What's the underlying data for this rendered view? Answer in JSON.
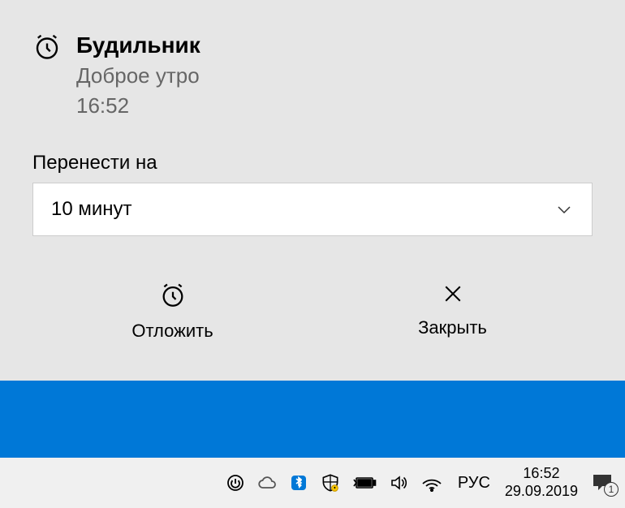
{
  "notification": {
    "title": "Будильник",
    "subtitle": "Доброе утро",
    "time": "16:52",
    "snooze_label": "Перенести на",
    "snooze_value": "10 минут",
    "actions": {
      "snooze": "Отложить",
      "dismiss": "Закрыть"
    }
  },
  "taskbar": {
    "language": "РУС",
    "time": "16:52",
    "date": "29.09.2019",
    "notification_count": "1"
  }
}
